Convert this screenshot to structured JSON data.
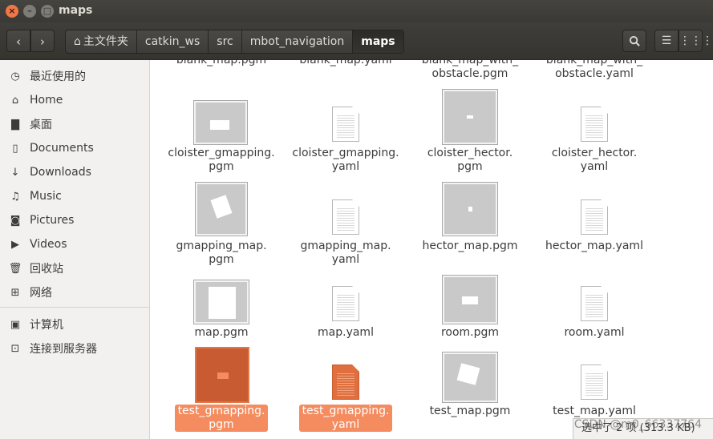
{
  "window": {
    "title": "maps"
  },
  "toolbar": {
    "breadcrumbs": [
      "主文件夹",
      "catkin_ws",
      "src",
      "mbot_navigation",
      "maps"
    ]
  },
  "sidebar": {
    "items": [
      {
        "label": "最近使用的",
        "icon": "clock-icon"
      },
      {
        "label": "Home",
        "icon": "home-icon"
      },
      {
        "label": "桌面",
        "icon": "desktop-folder-icon"
      },
      {
        "label": "Documents",
        "icon": "document-icon"
      },
      {
        "label": "Downloads",
        "icon": "download-icon"
      },
      {
        "label": "Music",
        "icon": "music-icon"
      },
      {
        "label": "Pictures",
        "icon": "camera-icon"
      },
      {
        "label": "Videos",
        "icon": "video-icon"
      },
      {
        "label": "回收站",
        "icon": "trash-icon"
      },
      {
        "label": "网络",
        "icon": "network-icon"
      },
      {
        "label": "计算机",
        "icon": "computer-icon"
      },
      {
        "label": "连接到服务器",
        "icon": "server-icon"
      }
    ]
  },
  "files": {
    "row0": [
      "blank_map.pgm",
      "blank_map.yaml",
      "blank_map_with_\nobstacle.pgm",
      "blank_map_with_\nobstacle.yaml"
    ],
    "row1": [
      "cloister_gmapping.\npgm",
      "cloister_gmapping.\nyaml",
      "cloister_hector.\npgm",
      "cloister_hector.\nyaml"
    ],
    "row2": [
      "gmapping_map.\npgm",
      "gmapping_map.\nyaml",
      "hector_map.pgm",
      "hector_map.yaml"
    ],
    "row3": [
      "map.pgm",
      "map.yaml",
      "room.pgm",
      "room.yaml"
    ],
    "row4": [
      "test_gmapping.\npgm",
      "test_gmapping.\nyaml",
      "test_map.pgm",
      "test_map.yaml"
    ]
  },
  "status": {
    "text": "选中了 2 项 (313.3 KB)"
  },
  "watermark": "CSDN @m0_66337764"
}
